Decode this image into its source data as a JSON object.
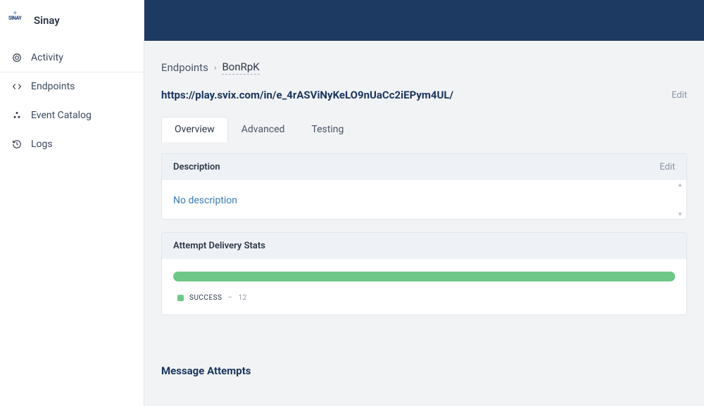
{
  "brand": {
    "logo_text": "SINAY",
    "name": "Sinay"
  },
  "nav": {
    "items": [
      {
        "label": "Activity"
      },
      {
        "label": "Endpoints"
      },
      {
        "label": "Event Catalog"
      },
      {
        "label": "Logs"
      }
    ]
  },
  "breadcrumb": {
    "parent": "Endpoints",
    "sep": "›",
    "current": "BonRpK"
  },
  "endpoint": {
    "url": "https://play.svix.com/in/e_4rASViNyKeLO9nUaCc2iEPym4UL/",
    "edit_label": "Edit"
  },
  "tabs": [
    {
      "label": "Overview",
      "active": true
    },
    {
      "label": "Advanced",
      "active": false
    },
    {
      "label": "Testing",
      "active": false
    }
  ],
  "description_card": {
    "title": "Description",
    "edit_label": "Edit",
    "empty_text": "No description"
  },
  "stats_card": {
    "title": "Attempt Delivery Stats",
    "success_label": "SUCCESS",
    "success_count": "12",
    "bar_color": "#6fc787"
  },
  "section": {
    "message_attempts": "Message Attempts"
  },
  "chart_data": {
    "type": "bar",
    "title": "Attempt Delivery Stats",
    "categories": [
      "SUCCESS"
    ],
    "values": [
      12
    ],
    "series": [
      {
        "name": "SUCCESS",
        "values": [
          12
        ],
        "color": "#6fc787"
      }
    ],
    "total": 12
  }
}
